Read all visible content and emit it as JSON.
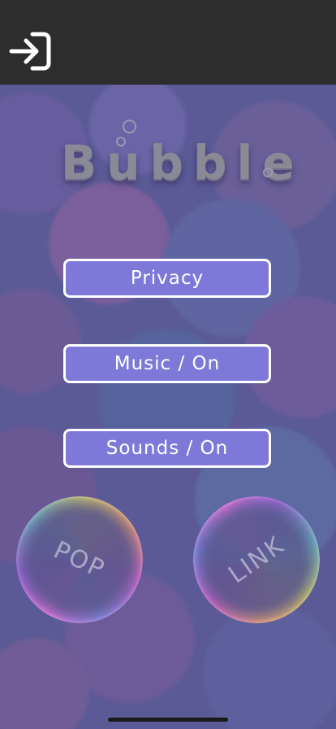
{
  "header": {
    "login_icon": "login-icon"
  },
  "app": {
    "title": "Bubble"
  },
  "menu": {
    "privacy_label": "Privacy",
    "music_label": "Music / On",
    "sounds_label": "Sounds / On"
  },
  "bubbles": {
    "pop_label": "POP",
    "link_label": "LINK"
  },
  "colors": {
    "topbar": "#2d2d2d",
    "background": "#5b5a96",
    "button_fill": "#7e79d8",
    "button_border": "#ffffff"
  }
}
